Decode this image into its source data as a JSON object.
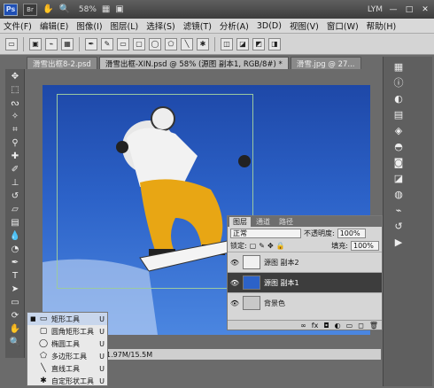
{
  "titlebar": {
    "ps": "Ps",
    "br": "Br",
    "zoom": "58%",
    "user": "LYM",
    "min": "—",
    "max": "□",
    "close": "✕"
  },
  "menu": [
    "文件(F)",
    "编辑(E)",
    "图像(I)",
    "图层(L)",
    "选择(S)",
    "滤镜(T)",
    "分析(A)",
    "3D(D)",
    "视图(V)",
    "窗口(W)",
    "帮助(H)"
  ],
  "tabs": [
    "滑雪出框8-2.psd",
    "滑雪出框-XIN.psd @ 58% (源图 副本1, RGB/8#) *",
    "滑雪.jpg @ 27..."
  ],
  "status": {
    "doc": "1.97M/15.5M"
  },
  "layers": {
    "tabs": [
      "图层",
      "通道",
      "路径"
    ],
    "blend_mode": "正常",
    "opacity_label": "不透明度:",
    "opacity": "100%",
    "lock_label": "锁定:",
    "fill_label": "填充:",
    "fill": "100%",
    "items": [
      "源图 副本2",
      "源图 副本1",
      "背景色"
    ],
    "footer_icons": [
      "∞",
      "fx",
      "◘",
      "◐",
      "▭",
      "◻",
      "🗑"
    ]
  },
  "flyout": {
    "items": [
      {
        "name": "矩形工具",
        "key": "U",
        "icon": "rect-icon"
      },
      {
        "name": "圆角矩形工具",
        "key": "U",
        "icon": "rounded-rect-icon"
      },
      {
        "name": "椭圆工具",
        "key": "U",
        "icon": "ellipse-icon"
      },
      {
        "name": "多边形工具",
        "key": "U",
        "icon": "polygon-icon"
      },
      {
        "name": "直线工具",
        "key": "U",
        "icon": "line-icon"
      },
      {
        "name": "自定形状工具",
        "key": "U",
        "icon": "custom-shape-icon"
      }
    ]
  },
  "colors": {
    "accent": "#2c62c8",
    "selected_layer": "#3d3d3d"
  }
}
